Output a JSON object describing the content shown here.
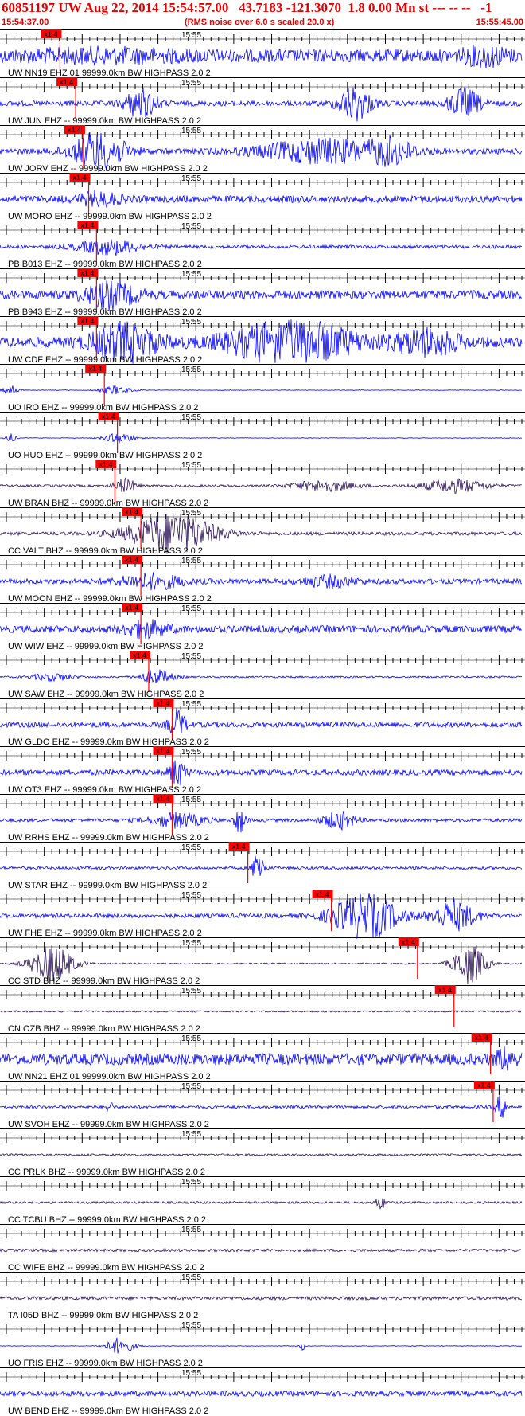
{
  "header": {
    "title": "60851197 UW Aug 22, 2014 15:54:57.00   43.7183 -121.3070  1.8 0.00 Mn st --- -- --   -1",
    "start_time": "15:54:37.00",
    "noise_note": "(RMS noise over 6.0 s scaled 20.0 x)",
    "end_time": "15:55:45.00"
  },
  "minute_label": "15:55",
  "pick_label": "x1.4",
  "colors": {
    "header_red": "#e00000",
    "trace_blue": "#0000ff",
    "trace_dark": "#1a0a4a",
    "pick_red": "#ff0000"
  },
  "traces": [
    {
      "label": "UW NN19 EHZ 01 99999.0km BW  HIGHPASS  2.0  2",
      "color": "#0000ff",
      "pick": 0.115,
      "amp": 0.45,
      "bursts": [
        [
          0.2,
          0.15,
          0.25
        ],
        [
          0.93,
          0.04,
          0.5
        ]
      ]
    },
    {
      "label": "UW JUN EHZ -- 99999.0km BW  HIGHPASS  2.0  2",
      "color": "#0000ff",
      "pick": 0.145,
      "amp": 0.18,
      "bursts": [
        [
          0.27,
          0.03,
          1.0
        ],
        [
          0.68,
          0.03,
          1.2
        ],
        [
          0.89,
          0.03,
          1.0
        ]
      ]
    },
    {
      "label": "UW JORV EHZ -- 99999.0km BW  HIGHPASS  2.0  2",
      "color": "#0000ff",
      "pick": 0.16,
      "amp": 0.2,
      "bursts": [
        [
          0.19,
          0.05,
          1.3
        ],
        [
          0.62,
          0.12,
          0.8
        ],
        [
          0.75,
          0.04,
          0.7
        ]
      ]
    },
    {
      "label": "UW MORO EHZ -- 99999.0km BW  HIGHPASS  2.0  2",
      "color": "#0000ff",
      "pick": 0.17,
      "amp": 0.25,
      "bursts": [
        [
          0.19,
          0.04,
          0.4
        ]
      ]
    },
    {
      "label": "PB B013 EHZ -- 99999.0km BW  HIGHPASS  2.0  2",
      "color": "#0000ff",
      "pick": 0.185,
      "amp": 0.12,
      "bursts": [
        [
          0.21,
          0.06,
          0.5
        ]
      ]
    },
    {
      "label": "PB B943 EHZ -- 99999.0km BW  HIGHPASS  2.0  2",
      "color": "#0000ff",
      "pick": 0.185,
      "amp": 0.3,
      "bursts": [
        [
          0.21,
          0.05,
          0.8
        ]
      ]
    },
    {
      "label": "UW CDF EHZ -- 99999.0km BW  HIGHPASS  2.0  2",
      "color": "#0000ff",
      "pick": 0.185,
      "amp": 0.35,
      "bursts": [
        [
          0.24,
          0.06,
          1.2
        ],
        [
          0.56,
          0.12,
          1.4
        ],
        [
          0.82,
          0.06,
          0.8
        ]
      ]
    },
    {
      "label": "UO IRO EHZ -- 99999.0km BW  HIGHPASS  2.0  2",
      "color": "#0000ff",
      "pick": 0.2,
      "amp": 0.02,
      "bursts": [
        [
          0.02,
          0.015,
          0.35
        ],
        [
          0.22,
          0.03,
          0.3
        ]
      ]
    },
    {
      "label": "UO HUO EHZ -- 99999.0km BW  HIGHPASS  2.0  2",
      "color": "#0000ff",
      "pick": 0.225,
      "amp": 0.02,
      "bursts": [
        [
          0.02,
          0.01,
          0.3
        ],
        [
          0.23,
          0.03,
          0.35
        ]
      ]
    },
    {
      "label": "UW BRAN BHZ -- 99999.0km BW  HIGHPASS  2.0  2",
      "color": "#2a1258",
      "pick": 0.22,
      "amp": 0.08,
      "bursts": [
        [
          0.24,
          0.02,
          0.5
        ],
        [
          0.62,
          0.06,
          0.35
        ],
        [
          0.87,
          0.06,
          0.45
        ]
      ]
    },
    {
      "label": "CC VALT BHZ -- 99999.0km BW  HIGHPASS  2.0  2",
      "color": "#2a1258",
      "pick": 0.27,
      "amp": 0.12,
      "bursts": [
        [
          0.33,
          0.08,
          1.4
        ]
      ]
    },
    {
      "label": "UW MOON EHZ -- 99999.0km BW  HIGHPASS  2.0  2",
      "color": "#0000ff",
      "pick": 0.27,
      "amp": 0.18,
      "bursts": [
        [
          0.29,
          0.06,
          0.5
        ],
        [
          0.63,
          0.05,
          0.35
        ]
      ]
    },
    {
      "label": "UW WIW EHZ -- 99999.0km BW  HIGHPASS  2.0  2",
      "color": "#0000ff",
      "pick": 0.27,
      "amp": 0.25,
      "bursts": [
        [
          0.28,
          0.04,
          0.5
        ]
      ]
    },
    {
      "label": "UW SAW EHZ -- 99999.0km BW  HIGHPASS  2.0  2",
      "color": "#0000ff",
      "pick": 0.285,
      "amp": 0.06,
      "bursts": [
        [
          0.1,
          0.04,
          0.25
        ],
        [
          0.3,
          0.03,
          0.5
        ]
      ]
    },
    {
      "label": "UW GLDO EHZ -- 99999.0km BW  HIGHPASS  2.0  2",
      "color": "#0000ff",
      "pick": 0.33,
      "amp": 0.18,
      "bursts": [
        [
          0.34,
          0.015,
          1.0
        ]
      ]
    },
    {
      "label": "UW OT3 EHZ -- 99999.0km BW  HIGHPASS  2.0  2",
      "color": "#0000ff",
      "pick": 0.33,
      "amp": 0.2,
      "bursts": [
        [
          0.34,
          0.015,
          0.9
        ]
      ]
    },
    {
      "label": "UW RRHS EHZ -- 99999.0km BW  HIGHPASS  2.0  2",
      "color": "#0000ff",
      "pick": 0.33,
      "amp": 0.12,
      "bursts": [
        [
          0.34,
          0.05,
          0.5
        ],
        [
          0.46,
          0.01,
          0.9
        ],
        [
          0.65,
          0.03,
          0.6
        ]
      ]
    },
    {
      "label": "UW STAR EHZ -- 99999.0km BW  HIGHPASS  2.0  2",
      "color": "#0000ff",
      "pick": 0.475,
      "amp": 0.1,
      "bursts": [
        [
          0.495,
          0.01,
          1.4
        ]
      ]
    },
    {
      "label": "UW FHE EHZ -- 99999.0km BW  HIGHPASS  2.0  2",
      "color": "#0000ff",
      "pick": 0.635,
      "amp": 0.15,
      "bursts": [
        [
          0.7,
          0.06,
          1.6
        ],
        [
          0.87,
          0.04,
          1.0
        ]
      ]
    },
    {
      "label": "CC STD BHZ -- 99999.0km BW  HIGHPASS  2.0  2",
      "color": "#2a1258",
      "pick": 0.8,
      "amp": 0.05,
      "bursts": [
        [
          0.1,
          0.04,
          1.3
        ],
        [
          0.9,
          0.03,
          1.4
        ]
      ]
    },
    {
      "label": "CN OZB BHZ -- 99999.0km BW  HIGHPASS  2.0  2",
      "color": "#2a1258",
      "pick": 0.87,
      "amp": 0.06,
      "bursts": []
    },
    {
      "label": "UW NN21 EHZ 01 99999.0km BW  HIGHPASS  2.0  2",
      "color": "#0000ff",
      "pick": 0.94,
      "amp": 0.4,
      "bursts": [
        [
          0.97,
          0.02,
          0.6
        ]
      ]
    },
    {
      "label": "UW SVOH EHZ -- 99999.0km BW  HIGHPASS  2.0  2",
      "color": "#0000ff",
      "pick": 0.945,
      "amp": 0.1,
      "bursts": [
        [
          0.21,
          0.005,
          0.6
        ],
        [
          0.96,
          0.01,
          0.8
        ]
      ]
    },
    {
      "label": "CC PRLK BHZ -- 99999.0km BW  HIGHPASS  2.0  2",
      "color": "#2a1258",
      "pick": null,
      "amp": 0.07,
      "bursts": []
    },
    {
      "label": "CC TCBU BHZ -- 99999.0km BW  HIGHPASS  2.0  2",
      "color": "#2a1258",
      "pick": null,
      "amp": 0.08,
      "bursts": [
        [
          0.73,
          0.01,
          0.4
        ]
      ]
    },
    {
      "label": "CC WIFE BHZ -- 99999.0km BW  HIGHPASS  2.0  2",
      "color": "#2a1258",
      "pick": null,
      "amp": 0.1,
      "bursts": []
    },
    {
      "label": "TA I05D BHZ -- 99999.0km BW  HIGHPASS  2.0  2",
      "color": "#2a1258",
      "pick": null,
      "amp": 0.12,
      "bursts": []
    },
    {
      "label": "UO FRIS EHZ -- 99999.0km BW  HIGHPASS  2.0  2",
      "color": "#0000ff",
      "pick": null,
      "amp": 0.02,
      "bursts": [
        [
          0.23,
          0.025,
          0.6
        ],
        [
          0.58,
          0.005,
          0.3
        ]
      ]
    },
    {
      "label": "UW BEND EHZ -- 99999.0km BW  HIGHPASS  2.0  2",
      "color": "#0000ff",
      "pick": null,
      "amp": 0.18,
      "bursts": []
    }
  ]
}
